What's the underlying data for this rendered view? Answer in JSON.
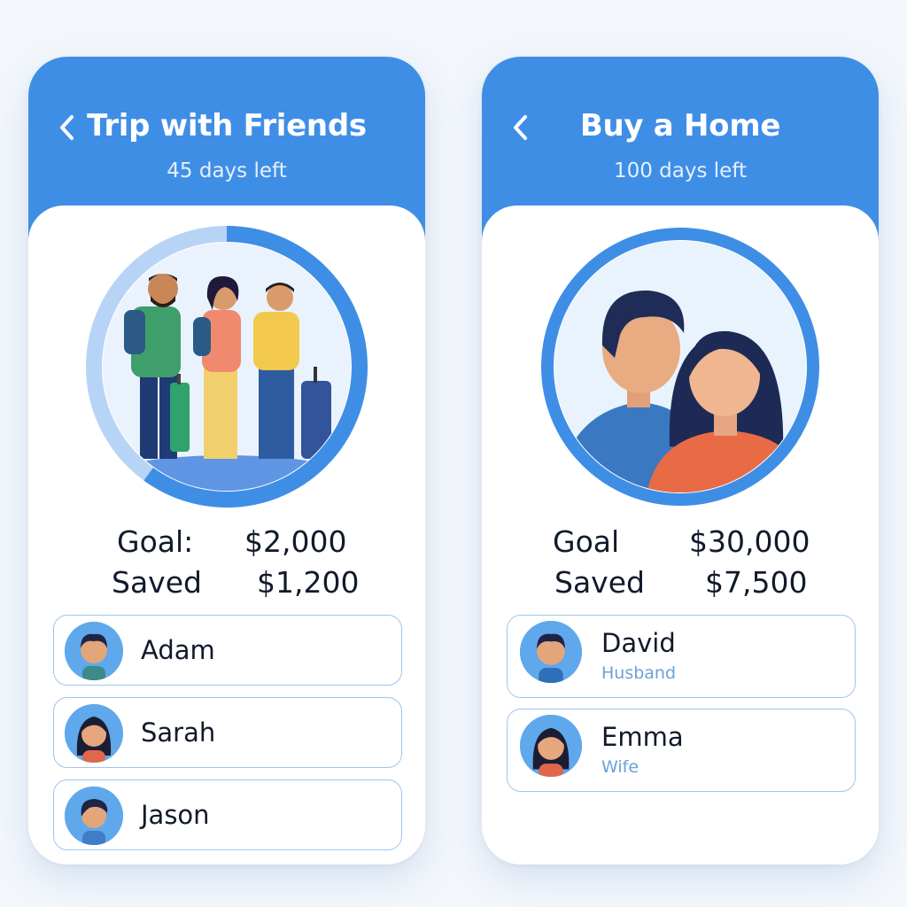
{
  "screens": [
    {
      "back_icon": "chevron-left-icon",
      "title": "Trip with Friends",
      "days_left": "45 days left",
      "progress": 0.6,
      "illustration": "friends-travel-illustration",
      "goal_label": "Goal:",
      "goal_value": "$2,000",
      "saved_label": "Saved",
      "saved_value": "$1,200",
      "members": [
        {
          "name": "Adam"
        },
        {
          "name": "Sarah"
        },
        {
          "name": "Jason"
        }
      ]
    },
    {
      "back_icon": "chevron-left-icon",
      "title": "Buy a Home",
      "days_left": "100 days left",
      "illustration": "couple-illustration",
      "goal_label": "Goal",
      "goal_value": "$30,000",
      "saved_label": "Saved",
      "saved_value": "$7,500",
      "members": [
        {
          "name": "David",
          "role": "Husband"
        },
        {
          "name": "Emma",
          "role": "Wife"
        }
      ]
    }
  ],
  "colors": {
    "primary": "#3f8ee6",
    "ring_track": "#b7d4f6",
    "card_border": "#9fc6ef",
    "text_dark": "#111a2b",
    "role_text": "#6d9fdc"
  }
}
